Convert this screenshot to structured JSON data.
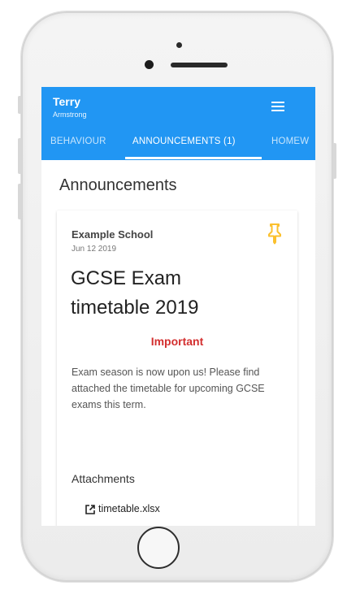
{
  "header": {
    "title": "Terry",
    "subtitle": "Armstrong",
    "menu_icon": "menu-icon"
  },
  "tabs": [
    {
      "label": "BEHAVIOUR",
      "active": false
    },
    {
      "label": "ANNOUNCEMENTS (1)",
      "active": true
    },
    {
      "label": "HOMEW",
      "active": false
    }
  ],
  "main": {
    "heading": "Announcements",
    "announcement": {
      "school": "Example School",
      "date": "Jun 12 2019",
      "pin_icon": "pin-icon",
      "title_line1": "GCSE Exam",
      "title_line2": "timetable 2019",
      "priority": "Important",
      "body": "Exam season is now upon us! Please find attached the timetable for upcoming GCSE exams this term.",
      "attachments_label": "Attachments",
      "attachments": [
        {
          "name": "timetable.xlsx",
          "icon": "open-external-icon"
        }
      ]
    }
  },
  "colors": {
    "app_bar": "#2196f3",
    "pin": "#fbc02d",
    "important": "#d32f2f"
  }
}
